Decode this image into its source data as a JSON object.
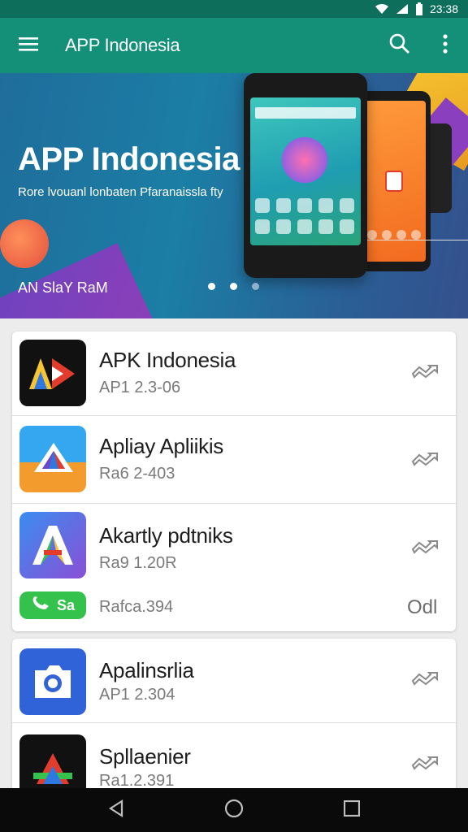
{
  "status_bar": {
    "time": "23:38",
    "icons": [
      "wifi-icon",
      "signal-icon",
      "battery-icon"
    ]
  },
  "app_bar": {
    "title": "APP Indonesia",
    "icons": [
      "menu-icon",
      "search-icon",
      "more-vert-icon"
    ]
  },
  "banner": {
    "title": "APP Indonesia",
    "subtitle": "Rore lvouanl lonbaten Pfaranaissla fty",
    "tag": "AN SlaY RaM",
    "carousel": {
      "count": 3,
      "active": 1
    }
  },
  "list_card_1": [
    {
      "name": "APK Indonesia",
      "meta": "AP1 2.3-06",
      "icon": "ad-logo-icon",
      "action": "arrow-icon"
    },
    {
      "name": "Apliay Apliikis",
      "meta": "Ra6 2-403",
      "icon": "delta-logo-icon",
      "action": "arrow-icon"
    },
    {
      "name": "Akartly pdtniks",
      "meta": "Ra9 1.20R",
      "icon": "a-logo-icon",
      "action": "arrow-icon"
    },
    {
      "name": "",
      "meta": "Rafca.394",
      "pill_text": "Sa",
      "icon": "phone-icon",
      "right_text": "Odl"
    }
  ],
  "list_card_2": [
    {
      "name": "Apalinsrlia",
      "meta": "AP1 2.304",
      "icon": "camera-logo-icon",
      "action": "arrow-icon"
    },
    {
      "name": "Spllaenier",
      "meta": "Ra1.2.391",
      "icon": "triangle-logo-icon",
      "action": "arrow-icon"
    }
  ],
  "nav_bar": {
    "icons": [
      "back-icon",
      "home-icon",
      "recents-icon"
    ]
  },
  "colors": {
    "status_bar": "#0e6e5c",
    "app_bar": "#149079",
    "pill": "#34c24c"
  }
}
